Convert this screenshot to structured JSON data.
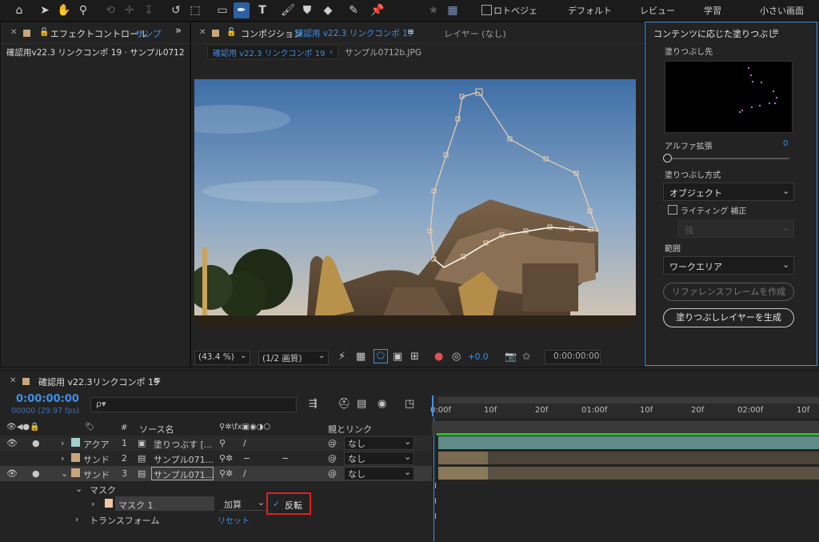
{
  "toolbar": {
    "tools": [
      "home-icon",
      "selection-arrow-icon",
      "hand-icon",
      "zoom-icon",
      "orbit-icon",
      "pan-icon",
      "dolly-icon",
      "rotate-icon",
      "region-icon",
      "rectangle-icon",
      "pen-icon",
      "type-icon",
      "brush-icon",
      "clone-stamp-icon",
      "eraser-icon",
      "roto-brush-icon",
      "puppet-pin-icon"
    ],
    "roto_bezier_label": "ロトベジェ",
    "workspaces": [
      "デフォルト",
      "レビュー",
      "学習",
      "小さい画面"
    ]
  },
  "effects_panel": {
    "tab_label": "エフェクトコントロール",
    "tab_suffix": "サンプ",
    "subtitle": "確認用v22.3 リンクコンポ 19 · サンプル0712"
  },
  "comp_panel": {
    "tab_prefix": "コンポジション",
    "tab_name": "確認用 v22.3 リンクコンポ 19",
    "layer_tab": "レイヤー (なし)",
    "breadcrumb_active": "確認用 v22.3 リンクコンポ 19",
    "breadcrumb_file": "サンプル0712b.JPG",
    "zoom": "(43.4 %)",
    "resolution": "(1/2 画質)",
    "exposure": "+0.0",
    "timecode": "0:00:00:00"
  },
  "fill_panel": {
    "title": "コンテンツに応じた塗りつぶし",
    "fill_target_label": "塗りつぶし先",
    "alpha_label": "アルファ拡張",
    "alpha_value": "0",
    "method_label": "塗りつぶし方式",
    "method_value": "オブジェクト",
    "lighting_label": "ライティング 補正",
    "lighting_value": "強",
    "range_label": "範囲",
    "range_value": "ワークエリア",
    "ref_button": "リファレンスフレームを作成",
    "generate_button": "塗りつぶしレイヤーを生成"
  },
  "timeline": {
    "tab_label": "確認用 v22.3リンクコンポ 19",
    "timecode": "0:00:00:00",
    "frame_info": "00000 (29.97 fps)",
    "search_placeholder": "ρ▾",
    "col_hash": "#",
    "col_source": "ソース名",
    "col_parent": "親とリンク",
    "ruler": [
      "0:00f",
      "10f",
      "20f",
      "01:00f",
      "10f",
      "20f",
      "02:00f",
      "10f"
    ],
    "layers": [
      {
        "color": "#9fd0c9",
        "color_name": "アクア",
        "index": "1",
        "name": "塗りつぶす [...",
        "parent": "なし"
      },
      {
        "color": "#c8a77c",
        "color_name": "サンド",
        "index": "2",
        "name": "サンプル071...",
        "parent": "なし"
      },
      {
        "color": "#c8a77c",
        "color_name": "サンド",
        "index": "3",
        "name": "サンプル071...",
        "parent": "なし"
      }
    ],
    "mask_group": "マスク",
    "mask_name": "マスク 1",
    "mask_mode": "加算",
    "invert_label": "反転",
    "transform_label": "トランスフォーム",
    "reset_label": "リセット"
  }
}
